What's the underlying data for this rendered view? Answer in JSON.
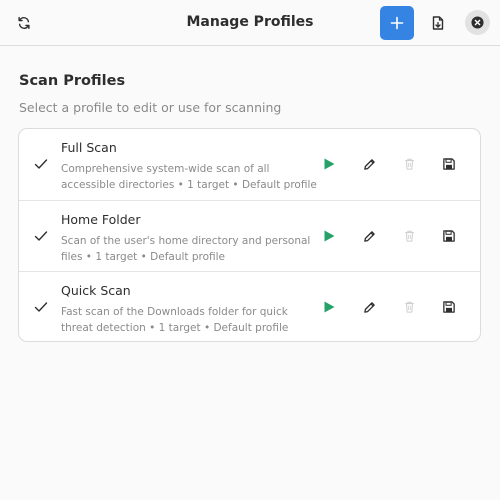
{
  "header": {
    "title": "Manage Profiles"
  },
  "section": {
    "title": "Scan Profiles",
    "subtitle": "Select a profile to edit or use for scanning"
  },
  "profiles": [
    {
      "name": "Full Scan",
      "description": "Comprehensive system-wide scan of all accessible directories • 1 target • Default profile"
    },
    {
      "name": "Home Folder",
      "description": "Scan of the user's home directory and personal files • 1 target • Default profile"
    },
    {
      "name": "Quick Scan",
      "description": "Fast scan of the Downloads folder for quick threat detection • 1 target • Default profile"
    }
  ],
  "icons": {
    "refresh": "refresh-icon",
    "add": "plus-icon",
    "import": "import-file-icon",
    "close": "close-icon",
    "selected": "checkmark-icon",
    "run": "play-icon",
    "edit": "pencil-icon",
    "delete": "trash-icon",
    "export": "floppy-disk-icon"
  },
  "colors": {
    "accent": "#3584e4",
    "run_green": "#26a269",
    "delete_disabled": "#cfcfcf"
  }
}
